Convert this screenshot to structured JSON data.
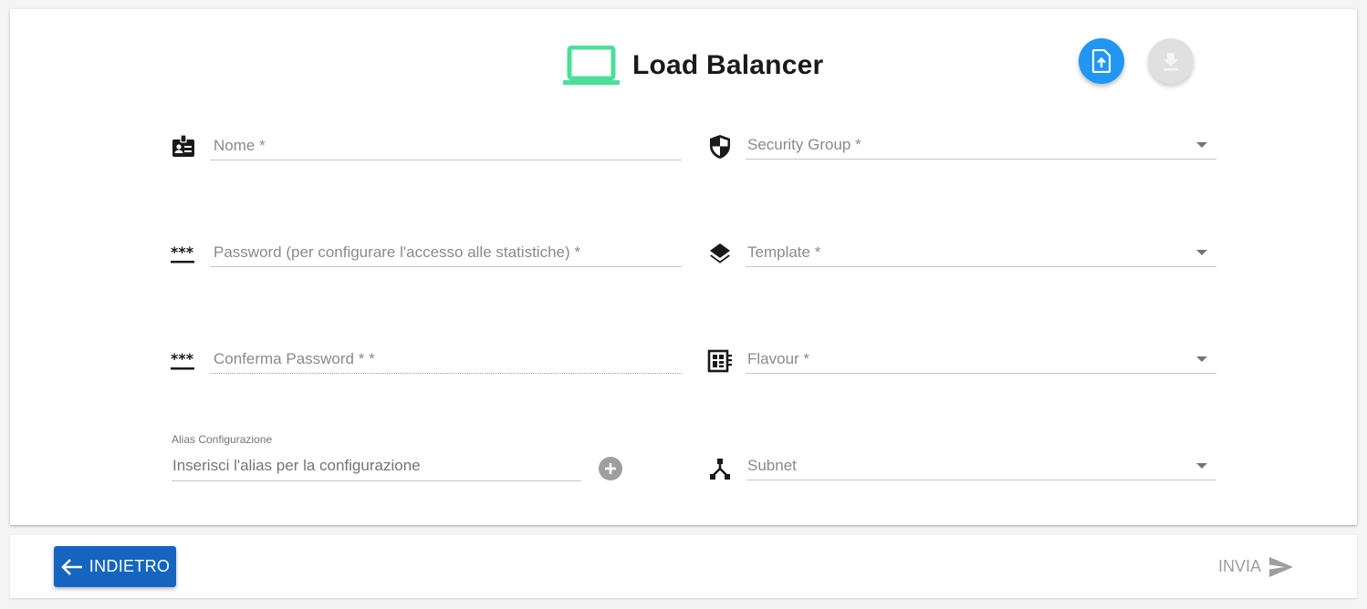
{
  "header": {
    "title": "Load Balancer",
    "title_icon": "laptop-icon",
    "accent_color": "#4cdf9a",
    "upload_button_icon": "file-upload-icon",
    "download_button_icon": "download-icon"
  },
  "form": {
    "nome": {
      "placeholder": "Nome *",
      "icon": "badge-icon"
    },
    "password": {
      "placeholder": "Password (per configurare l'accesso alle statistiche) *",
      "icon": "password-icon"
    },
    "conferma_password": {
      "placeholder": "Conferma Password * *",
      "icon": "password-icon"
    },
    "alias": {
      "label": "Alias Configurazione",
      "placeholder": "Inserisci l'alias per la configurazione",
      "add_icon": "add-circle-icon"
    },
    "security_group": {
      "placeholder": "Security Group *",
      "icon": "shield-icon"
    },
    "template": {
      "placeholder": "Template *",
      "icon": "layers-icon"
    },
    "flavour": {
      "placeholder": "Flavour *",
      "icon": "memory-chip-icon"
    },
    "subnet": {
      "placeholder": "Subnet",
      "icon": "network-icon"
    }
  },
  "footer": {
    "back_label": "INDIETRO",
    "send_label": "INVIA",
    "primary_color": "#1565c0",
    "disabled_color": "#9e9e9e"
  }
}
